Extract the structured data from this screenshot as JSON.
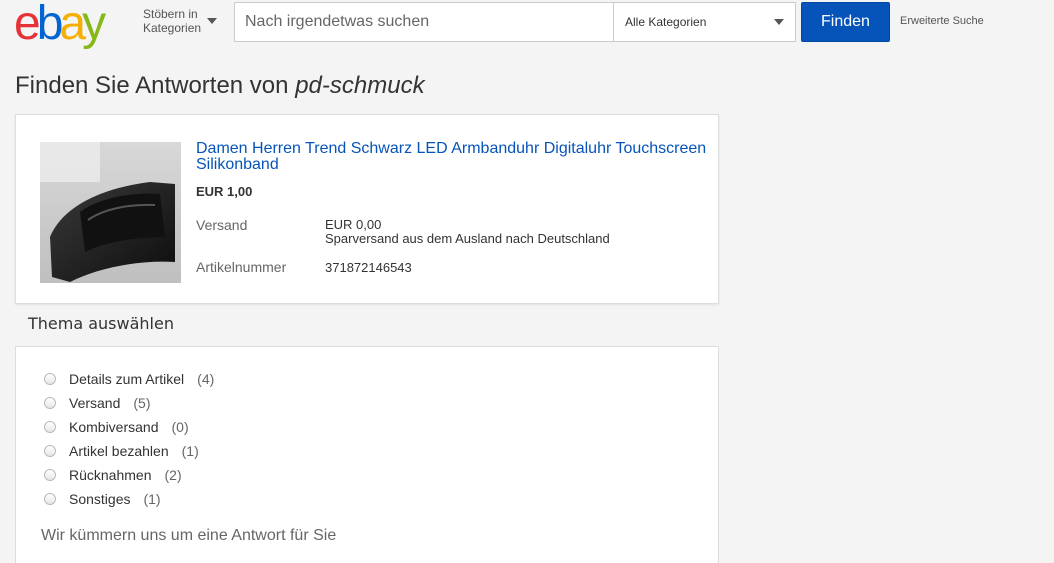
{
  "header": {
    "logo_text": "ebay",
    "browse_line1": "Stöbern in",
    "browse_line2": "Kategorien",
    "search_placeholder": "Nach irgendetwas suchen",
    "category_selected": "Alle Kategorien",
    "find_button": "Finden",
    "advanced_search": "Erweiterte Suche"
  },
  "page": {
    "title_prefix": "Finden Sie Antworten von",
    "seller": "pd-schmuck"
  },
  "item": {
    "title": "Damen Herren Trend Schwarz LED Armbanduhr Digitaluhr Touchscreen Silikonband",
    "price": "EUR 1,00",
    "shipping_label": "Versand",
    "shipping_cost": "EUR 0,00",
    "shipping_desc": "Sparversand aus dem Ausland nach Deutschland",
    "itemno_label": "Artikelnummer",
    "itemno_value": "371872146543"
  },
  "topics": {
    "heading": "Thema auswählen",
    "items": [
      {
        "label": "Details zum Artikel",
        "count": "(4)"
      },
      {
        "label": "Versand",
        "count": "(5)"
      },
      {
        "label": "Kombiversand",
        "count": "(0)"
      },
      {
        "label": "Artikel bezahlen",
        "count": "(1)"
      },
      {
        "label": "Rücknahmen",
        "count": "(2)"
      },
      {
        "label": "Sonstiges",
        "count": "(1)"
      }
    ],
    "help_text": "Wir kümmern uns um eine Antwort für Sie"
  },
  "colors": {
    "primary_button": "#0654ba",
    "link": "#0654ba"
  }
}
